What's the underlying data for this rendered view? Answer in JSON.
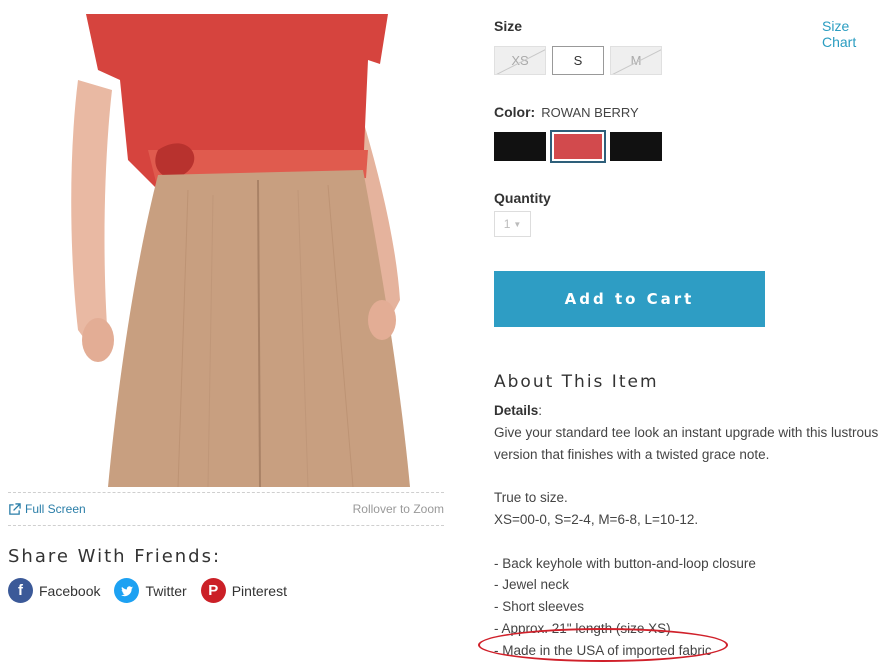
{
  "product": {
    "image_alt_icon": "product-photo"
  },
  "zoom": {
    "full_screen_label": "Full Screen",
    "rollover_label": "Rollover to Zoom"
  },
  "share": {
    "title": "Share With Friends:",
    "items": [
      {
        "label": "Facebook",
        "icon": "facebook-icon",
        "color": "#3b5998"
      },
      {
        "label": "Twitter",
        "icon": "twitter-icon",
        "color": "#1da1f2"
      },
      {
        "label": "Pinterest",
        "icon": "pinterest-icon",
        "color": "#cb2027"
      }
    ]
  },
  "size": {
    "label": "Size",
    "chart_link": "Size Chart",
    "options": [
      {
        "label": "XS",
        "available": false
      },
      {
        "label": "S",
        "available": true,
        "selected": true
      },
      {
        "label": "M",
        "available": false
      }
    ]
  },
  "color": {
    "label": "Color:",
    "selected_name": "ROWAN BERRY",
    "swatches": [
      {
        "color": "#111111"
      },
      {
        "color": "#d24a4d",
        "selected": true
      },
      {
        "color": "#111111"
      }
    ]
  },
  "quantity": {
    "label": "Quantity",
    "value": "1"
  },
  "cart": {
    "button_label": "Add to Cart",
    "button_color": "#2e9dc4"
  },
  "about": {
    "title": "About This Item",
    "details_label": "Details",
    "description": "Give your standard tee look an instant upgrade with this lustrous version that finishes with a twisted grace note.",
    "fit_note": "True to size.",
    "size_conversion": "XS=00-0, S=2-4, M=6-8, L=10-12.",
    "features": [
      "- Back keyhole with button-and-loop closure",
      "- Jewel neck",
      "- Short sleeves",
      "- Approx. 21\" length (size XS)",
      "- Made in the USA of imported fabric"
    ],
    "highlight_color": "#d0202a"
  }
}
